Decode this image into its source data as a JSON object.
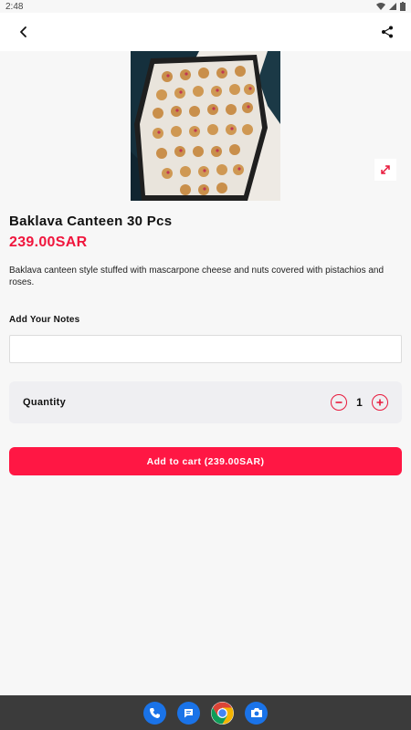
{
  "status_bar": {
    "time": "2:48"
  },
  "app_bar": {
    "back_icon": "arrow-back-icon",
    "share_icon": "share-icon"
  },
  "product": {
    "name": "Baklava Canteen 30 Pcs",
    "price": "239.00SAR",
    "description": "Baklava canteen style stuffed with mascarpone cheese and nuts covered with pistachios and roses."
  },
  "notes": {
    "label": "Add Your Notes",
    "value": "",
    "placeholder": ""
  },
  "quantity": {
    "label": "Quantity",
    "value": "1"
  },
  "cart": {
    "button_label": "Add to cart (239.00SAR)"
  },
  "colors": {
    "accent": "#ff1744",
    "price": "#f0163d"
  },
  "nav_dock": [
    "phone-icon",
    "messages-icon",
    "chrome-icon",
    "camera-icon"
  ]
}
